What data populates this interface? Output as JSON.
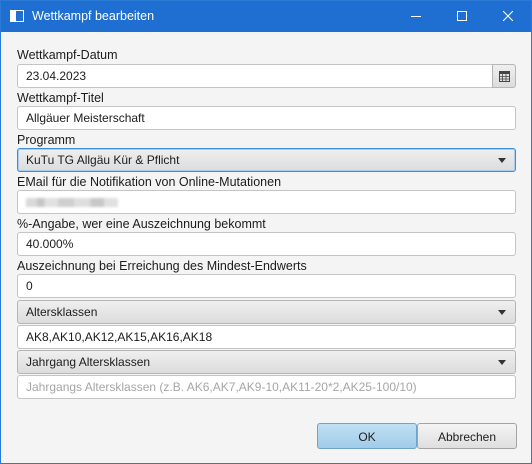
{
  "window": {
    "title": "Wettkampf bearbeiten"
  },
  "form": {
    "date": {
      "label": "Wettkampf-Datum",
      "value": "23.04.2023"
    },
    "title": {
      "label": "Wettkampf-Titel",
      "value": "Allgäuer Meisterschaft"
    },
    "program": {
      "label": "Programm",
      "value": "KuTu TG Allgäu Kür & Pflicht"
    },
    "email": {
      "label": "EMail für die Notifikation von Online-Mutationen",
      "value_redacted": true
    },
    "percent": {
      "label": "%-Angabe, wer eine Auszeichnung bekommt",
      "value": "40.000%"
    },
    "award_min": {
      "label": "Auszeichnung bei Erreichung des Mindest-Endwerts",
      "value": "0"
    },
    "age_classes": {
      "combo_value": "Altersklassen",
      "value": "AK8,AK10,AK12,AK15,AK16,AK18"
    },
    "year_classes": {
      "combo_value": "Jahrgang Altersklassen",
      "placeholder": "Jahrgangs Altersklassen (z.B. AK6,AK7,AK9-10,AK11-20*2,AK25-100/10)"
    }
  },
  "buttons": {
    "ok": "OK",
    "cancel": "Abbrechen"
  },
  "colors": {
    "titlebar": "#1e6fd1",
    "default_button": "#a1cbe9",
    "focus_border": "#3b8fd6"
  },
  "icons": {
    "calendar": "calendar-icon",
    "dropdown": "chevron-down-icon"
  }
}
